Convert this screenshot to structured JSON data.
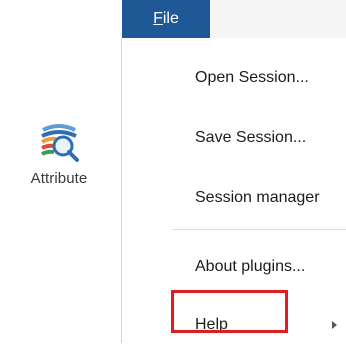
{
  "toolbar": {
    "tool_label": "Attribute",
    "tool_icon": "attribute-table-search-icon"
  },
  "menubar": {
    "active_menu": "File",
    "mnemonic_letter": "F",
    "menu_rest": "ile"
  },
  "file_menu": {
    "items": [
      {
        "label": "Open Session...",
        "has_submenu": false
      },
      {
        "label": "Save Session...",
        "has_submenu": false
      },
      {
        "label": "Session manager",
        "has_submenu": false
      },
      {
        "label": "About plugins...",
        "has_submenu": false
      },
      {
        "label": "Help",
        "has_submenu": true,
        "highlighted": true
      }
    ]
  },
  "colors": {
    "menubar_active": "#1e5896",
    "highlight_border": "#e21b1b",
    "icon_band_1": "#2f6db5",
    "icon_band_2": "#5aa0d8",
    "icon_band_3": "#e6a33a",
    "icon_band_4": "#d94b3a"
  }
}
